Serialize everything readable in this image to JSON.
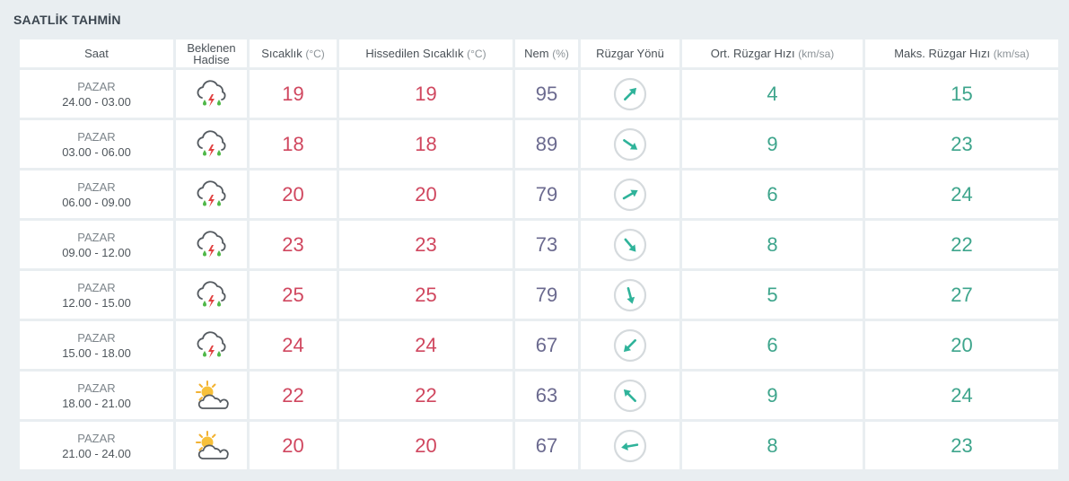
{
  "section_title": "SAATLİK TAHMİN",
  "headers": {
    "saat": "Saat",
    "hadise_line1": "Beklenen",
    "hadise_line2": "Hadise",
    "sicaklik": "Sıcaklık",
    "sicaklik_unit": "(°C)",
    "hissedilen": "Hissedilen Sıcaklık",
    "hissedilen_unit": "(°C)",
    "nem": "Nem",
    "nem_unit": "(%)",
    "ruzgar_yonu": "Rüzgar Yönü",
    "ort_ruzgar": "Ort. Rüzgar Hızı",
    "ort_ruzgar_unit": "(km/sa)",
    "maks_ruzgar": "Maks. Rüzgar Hızı",
    "maks_ruzgar_unit": "(km/sa)"
  },
  "rows": [
    {
      "day": "PAZAR",
      "time": "24.00 - 03.00",
      "icon": "thunderstorm-rain-icon",
      "temp": "19",
      "feels": "19",
      "humidity": "95",
      "wind_dir_deg": 45,
      "wind_avg": "4",
      "wind_max": "15"
    },
    {
      "day": "PAZAR",
      "time": "03.00 - 06.00",
      "icon": "thunderstorm-rain-icon",
      "temp": "18",
      "feels": "18",
      "humidity": "89",
      "wind_dir_deg": 125,
      "wind_avg": "9",
      "wind_max": "23"
    },
    {
      "day": "PAZAR",
      "time": "06.00 - 09.00",
      "icon": "thunderstorm-rain-icon",
      "temp": "20",
      "feels": "20",
      "humidity": "79",
      "wind_dir_deg": 60,
      "wind_avg": "6",
      "wind_max": "24"
    },
    {
      "day": "PAZAR",
      "time": "09.00 - 12.00",
      "icon": "thunderstorm-rain-icon",
      "temp": "23",
      "feels": "23",
      "humidity": "73",
      "wind_dir_deg": 140,
      "wind_avg": "8",
      "wind_max": "22"
    },
    {
      "day": "PAZAR",
      "time": "12.00 - 15.00",
      "icon": "thunderstorm-rain-icon",
      "temp": "25",
      "feels": "25",
      "humidity": "79",
      "wind_dir_deg": 165,
      "wind_avg": "5",
      "wind_max": "27"
    },
    {
      "day": "PAZAR",
      "time": "15.00 - 18.00",
      "icon": "thunderstorm-rain-icon",
      "temp": "24",
      "feels": "24",
      "humidity": "67",
      "wind_dir_deg": 225,
      "wind_avg": "6",
      "wind_max": "20"
    },
    {
      "day": "PAZAR",
      "time": "18.00 - 21.00",
      "icon": "partly-cloudy-icon",
      "temp": "22",
      "feels": "22",
      "humidity": "63",
      "wind_dir_deg": 315,
      "wind_avg": "9",
      "wind_max": "24"
    },
    {
      "day": "PAZAR",
      "time": "21.00 - 24.00",
      "icon": "partly-cloudy-icon",
      "temp": "20",
      "feels": "20",
      "humidity": "67",
      "wind_dir_deg": 260,
      "wind_avg": "8",
      "wind_max": "23"
    }
  ],
  "colors": {
    "temperature": "#d0475f",
    "humidity": "#6b6a8f",
    "wind": "#3ea58c",
    "arrow": "#2fb39a",
    "background": "#e9eef1"
  }
}
